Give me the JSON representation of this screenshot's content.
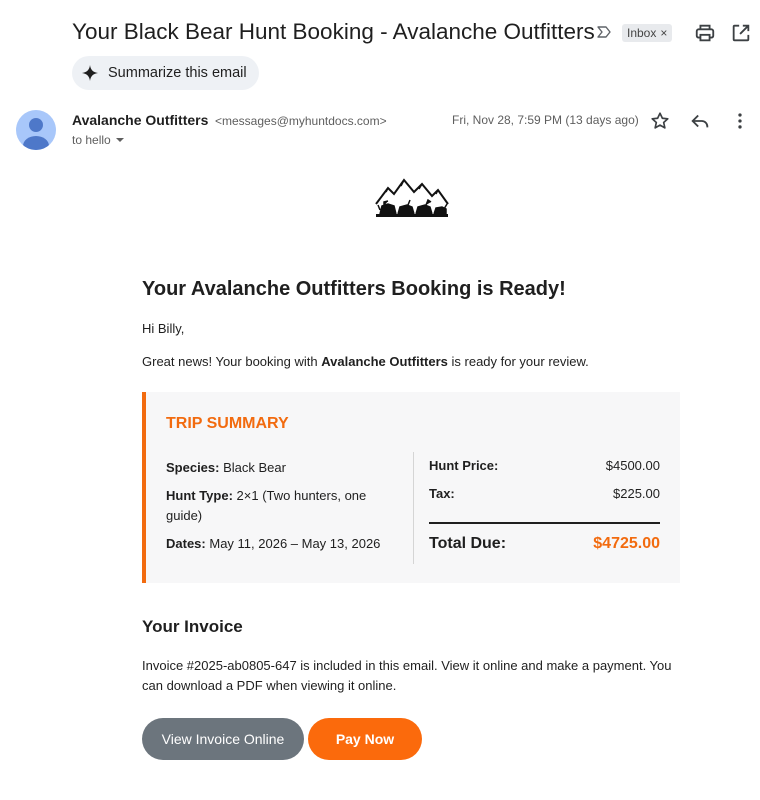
{
  "email": {
    "subject": "Your Black Bear Hunt Booking - Avalanche Outfitters",
    "label_chip": "Inbox",
    "label_chip_close": "×",
    "summarize_label": "Summarize this email"
  },
  "sender": {
    "name": "Avalanche Outfitters",
    "email": "<messages@myhuntdocs.com>",
    "to_line": "to hello",
    "date": "Fri, Nov 28, 7:59 PM (13 days ago)"
  },
  "body": {
    "heading": "Your Avalanche Outfitters Booking is Ready!",
    "greeting": "Hi Billy,",
    "intro_prefix": "Great news! Your booking with ",
    "intro_bold": "Avalanche Outfitters",
    "intro_suffix": " is ready for your review.",
    "summary": {
      "title": "TRIP SUMMARY",
      "species_label": "Species:",
      "species_value": " Black Bear",
      "hunt_type_label": "Hunt Type:",
      "hunt_type_value": " 2×1 (Two hunters, one guide)",
      "dates_label": "Dates:",
      "dates_value": " May 11, 2026 – May 13, 2026",
      "price_label": "Hunt Price:",
      "price_value": "$4500.00",
      "tax_label": "Tax:",
      "tax_value": "$225.00",
      "total_label": "Total Due:",
      "total_value": "$4725.00"
    },
    "invoice_heading": "Your Invoice",
    "invoice_text": "Invoice #2025-ab0805-647 is included in this email. View it online and make a payment. You can download a PDF when viewing it online.",
    "view_button": "View Invoice Online",
    "pay_button": "Pay Now"
  },
  "colors": {
    "accent": "#f26b0f",
    "pay_button": "#fb6a0c",
    "view_button": "#6c757d",
    "avatar": "#a8c7fa"
  }
}
